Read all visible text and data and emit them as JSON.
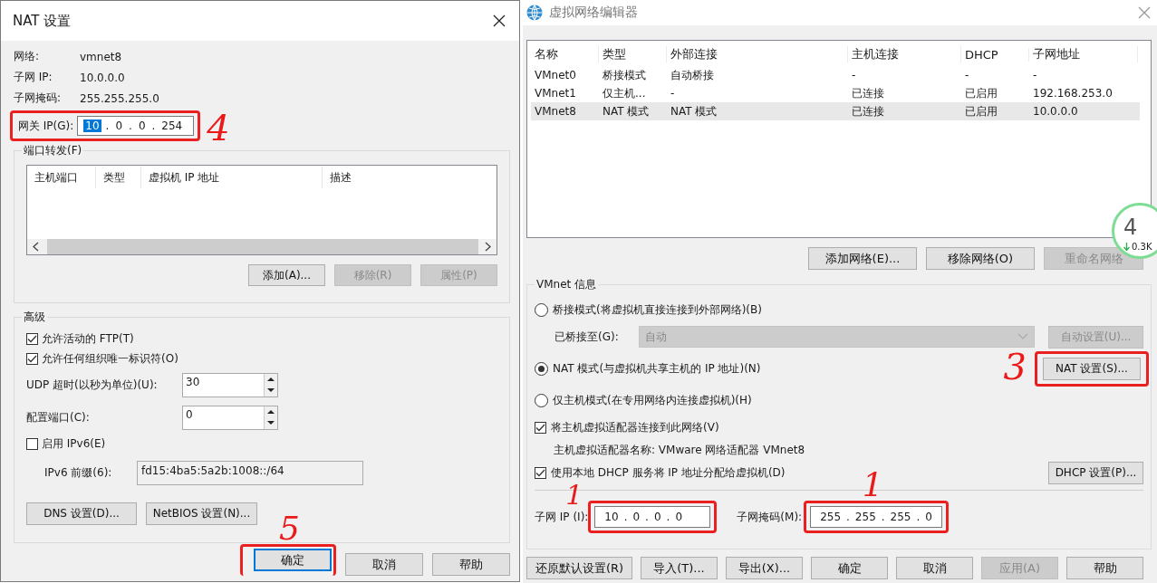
{
  "nat_dialog": {
    "title": "NAT 设置",
    "info": [
      {
        "label": "网络:",
        "value": "vmnet8"
      },
      {
        "label": "子网 IP:",
        "value": "10.0.0.0"
      },
      {
        "label": "子网掩码:",
        "value": "255.255.255.0"
      }
    ],
    "gateway": {
      "label": "网关 IP(G):",
      "separator": ".",
      "octets": [
        {
          "value": "10",
          "selected": true
        },
        {
          "value": "0",
          "selected": false
        },
        {
          "value": "0",
          "selected": false
        },
        {
          "value": "254",
          "selected": false
        }
      ],
      "annotation": {
        "label": "4"
      }
    },
    "port_forwarding": {
      "title": "端口转发(F)",
      "columns": [
        "主机端口",
        "类型",
        "虚拟机 IP 地址",
        "描述"
      ],
      "buttons": [
        {
          "label": "添加(A)...",
          "disabled": false
        },
        {
          "label": "移除(R)",
          "disabled": true
        },
        {
          "label": "属性(P)",
          "disabled": true
        }
      ]
    },
    "advanced": {
      "title": "高级",
      "options": [
        {
          "kind": "checkbox",
          "label": "允许活动的 FTP(T)",
          "checked": true
        },
        {
          "kind": "checkbox",
          "label": "允许任何组织唯一标识符(O)",
          "checked": true
        },
        {
          "kind": "spin",
          "label": "UDP 超时(以秒为单位)(U):",
          "value": "30"
        },
        {
          "kind": "spin",
          "label": "配置端口(C):",
          "value": "0"
        },
        {
          "kind": "checkbox",
          "label": "启用 IPv6(E)",
          "checked": false
        },
        {
          "kind": "text",
          "label": "IPv6 前缀(6):",
          "value": "fd15:4ba5:5a2b:1008::/64",
          "disabled": true
        }
      ],
      "buttons": [
        {
          "label": "DNS 设置(D)..."
        },
        {
          "label": "NetBIOS 设置(N)..."
        }
      ]
    },
    "buttons": [
      {
        "label": "确定",
        "default": true,
        "annotation": {
          "label": "5"
        }
      },
      {
        "label": "取消",
        "default": false
      },
      {
        "label": "帮助",
        "default": false
      }
    ]
  },
  "network_editor": {
    "title": "虚拟网络编辑器",
    "table": {
      "columns": [
        "名称",
        "类型",
        "外部连接",
        "主机连接",
        "DHCP",
        "子网地址"
      ],
      "rows": [
        {
          "cells": [
            "VMnet0",
            "桥接模式",
            "自动桥接",
            "-",
            "-",
            "-"
          ],
          "selected": false
        },
        {
          "cells": [
            "VMnet1",
            "仅主机...",
            "-",
            "已连接",
            "已启用",
            "192.168.253.0"
          ],
          "selected": false
        },
        {
          "cells": [
            "VMnet8",
            "NAT 模式",
            "NAT 模式",
            "已连接",
            "已启用",
            "10.0.0.0"
          ],
          "selected": true
        }
      ]
    },
    "table_buttons": [
      {
        "label": "添加网络(E)...",
        "disabled": false
      },
      {
        "label": "移除网络(O)",
        "disabled": false
      },
      {
        "label": "重命名网络",
        "disabled": true
      }
    ],
    "info": {
      "title": "VMnet 信息",
      "bridge": {
        "label": "桥接模式(将虚拟机直接连接到外部网络)(B)",
        "selected": false
      },
      "bridged_to": {
        "label": "已桥接至(G):",
        "value": "自动",
        "disabled": true,
        "button": {
          "label": "自动设置(U)...",
          "disabled": true
        }
      },
      "nat": {
        "label": "NAT 模式(与虚拟机共享主机的 IP 地址)(N)",
        "selected": true,
        "button": {
          "label": "NAT 设置(S)...",
          "annotation": {
            "label": "3"
          }
        }
      },
      "host_only": {
        "label": "仅主机模式(在专用网络内连接虚拟机)(H)",
        "selected": false
      },
      "connect_adapter": {
        "label": "将主机虚拟适配器连接到此网络(V)",
        "checked": true
      },
      "adapter_name": "主机虚拟适配器名称: VMware 网络适配器 VMnet8",
      "dhcp": {
        "label": "使用本地 DHCP 服务将 IP 地址分配给虚拟机(D)",
        "checked": true,
        "button": {
          "label": "DHCP 设置(P)..."
        }
      },
      "subnet_ip": {
        "label": "子网 IP (I):",
        "separator": ".",
        "octets": [
          "10",
          "0",
          "0",
          "0"
        ],
        "annotation": {
          "label": "1"
        }
      },
      "subnet_mask": {
        "label": "子网掩码(M):",
        "separator": ".",
        "octets": [
          "255",
          "255",
          "255",
          "0"
        ],
        "annotation": {
          "label": "1"
        }
      }
    },
    "buttons": [
      {
        "label": "还原默认设置(R)",
        "disabled": false
      },
      {
        "label": "导入(T)...",
        "disabled": false
      },
      {
        "label": "导出(X)...",
        "disabled": false
      },
      {
        "label": "确定",
        "disabled": false
      },
      {
        "label": "取消",
        "disabled": false
      },
      {
        "label": "应用(A)",
        "disabled": true
      },
      {
        "label": "帮助",
        "disabled": false
      }
    ],
    "speed_widget": {
      "value": "4",
      "rate": "0.3K"
    }
  }
}
